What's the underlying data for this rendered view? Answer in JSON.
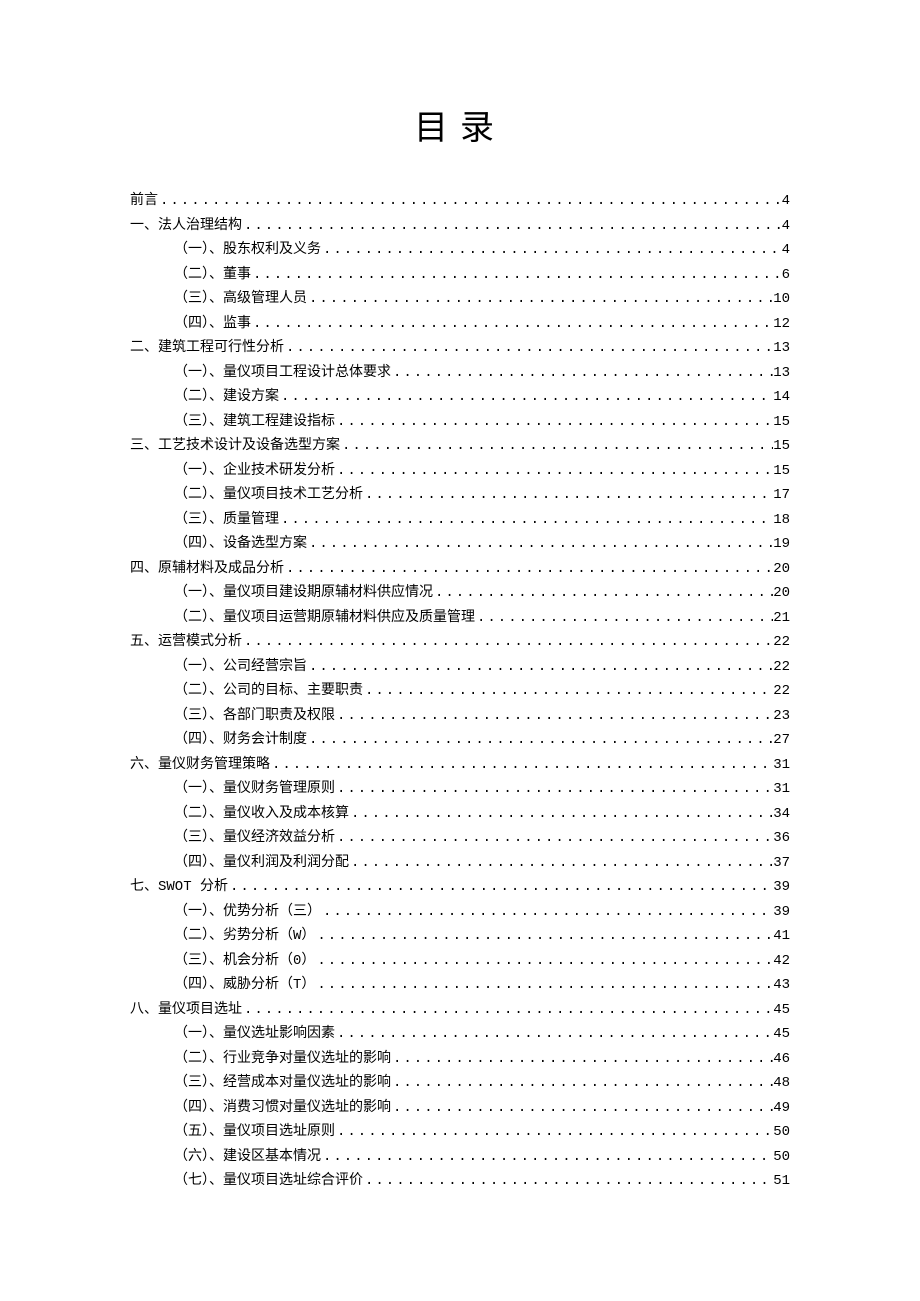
{
  "title": "目录",
  "toc": [
    {
      "level": 1,
      "label": "前言",
      "page": "4"
    },
    {
      "level": 1,
      "label": "一、法人治理结构",
      "page": "4"
    },
    {
      "level": 2,
      "label": "（一）、股东权利及义务",
      "page": "4"
    },
    {
      "level": 2,
      "label": "（二）、董事",
      "page": "6"
    },
    {
      "level": 2,
      "label": "（三）、高级管理人员",
      "page": "10"
    },
    {
      "level": 2,
      "label": "（四）、监事",
      "page": "12"
    },
    {
      "level": 1,
      "label": "二、建筑工程可行性分析",
      "page": "13"
    },
    {
      "level": 2,
      "label": "（一）、量仪项目工程设计总体要求",
      "page": "13"
    },
    {
      "level": 2,
      "label": "（二）、建设方案",
      "page": "14"
    },
    {
      "level": 2,
      "label": "（三）、建筑工程建设指标",
      "page": "15"
    },
    {
      "level": 1,
      "label": "三、工艺技术设计及设备选型方案",
      "page": "15"
    },
    {
      "level": 2,
      "label": "（一）、企业技术研发分析",
      "page": "15"
    },
    {
      "level": 2,
      "label": "（二）、量仪项目技术工艺分析",
      "page": "17"
    },
    {
      "level": 2,
      "label": "（三）、质量管理",
      "page": "18"
    },
    {
      "level": 2,
      "label": "（四）、设备选型方案",
      "page": "19"
    },
    {
      "level": 1,
      "label": "四、原辅材料及成品分析",
      "page": "20"
    },
    {
      "level": 2,
      "label": "（一）、量仪项目建设期原辅材料供应情况",
      "page": "20"
    },
    {
      "level": 2,
      "label": "（二）、量仪项目运营期原辅材料供应及质量管理",
      "page": "21"
    },
    {
      "level": 1,
      "label": "五、运营模式分析",
      "page": "22"
    },
    {
      "level": 2,
      "label": "（一）、公司经营宗旨",
      "page": "22"
    },
    {
      "level": 2,
      "label": "（二）、公司的目标、主要职责",
      "page": "22"
    },
    {
      "level": 2,
      "label": "（三）、各部门职责及权限",
      "page": "23"
    },
    {
      "level": 2,
      "label": "（四）、财务会计制度",
      "page": "27"
    },
    {
      "level": 1,
      "label": "六、量仪财务管理策略",
      "page": "31"
    },
    {
      "level": 2,
      "label": "（一）、量仪财务管理原则",
      "page": "31"
    },
    {
      "level": 2,
      "label": "（二）、量仪收入及成本核算",
      "page": "34"
    },
    {
      "level": 2,
      "label": "（三）、量仪经济效益分析",
      "page": "36"
    },
    {
      "level": 2,
      "label": "（四）、量仪利润及利润分配",
      "page": "37"
    },
    {
      "level": 1,
      "label": "七、SWOT 分析",
      "page": "39"
    },
    {
      "level": 2,
      "label": "（一）、优势分析（三）",
      "page": "39"
    },
    {
      "level": 2,
      "label": "（二）、劣势分析（W）",
      "page": "41"
    },
    {
      "level": 2,
      "label": "（三）、机会分析（0）",
      "page": "42"
    },
    {
      "level": 2,
      "label": "（四）、威胁分析（T）",
      "page": "43"
    },
    {
      "level": 1,
      "label": "八、量仪项目选址",
      "page": "45"
    },
    {
      "level": 2,
      "label": "（一）、量仪选址影响因素",
      "page": "45"
    },
    {
      "level": 2,
      "label": "（二）、行业竞争对量仪选址的影响",
      "page": "46"
    },
    {
      "level": 2,
      "label": "（三）、经营成本对量仪选址的影响",
      "page": "48"
    },
    {
      "level": 2,
      "label": "（四）、消费习惯对量仪选址的影响",
      "page": "49"
    },
    {
      "level": 2,
      "label": "（五）、量仪项目选址原则",
      "page": "50"
    },
    {
      "level": 2,
      "label": "（六）、建设区基本情况",
      "page": "50"
    },
    {
      "level": 2,
      "label": "（七）、量仪项目选址综合评价",
      "page": "51"
    }
  ]
}
